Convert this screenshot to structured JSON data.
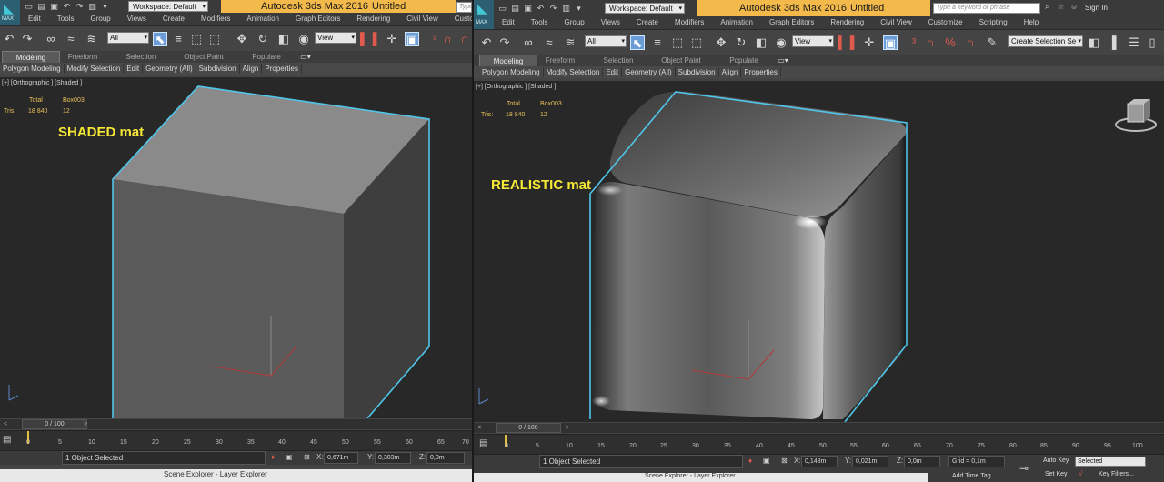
{
  "left": {
    "title": "Autodesk 3ds Max 2016",
    "untitled": "Untitled",
    "logo_text": "MAX",
    "workspace": "Workspace: Default",
    "search_partial": "Type",
    "menu": [
      "Edit",
      "Tools",
      "Group",
      "Views",
      "Create",
      "Modifiers",
      "Animation",
      "Graph Editors",
      "Rendering",
      "Civil View",
      "Customiz"
    ],
    "selection_filter": "All",
    "view_dropdown": "View",
    "ribbon_tabs": [
      "Modeling",
      "Freeform",
      "Selection",
      "Object Paint",
      "Populate"
    ],
    "sub_ribbon": [
      "Polygon Modeling",
      "Modify Selection",
      "Edit",
      "Geometry (All)",
      "Subdivision",
      "Align",
      "Properties"
    ],
    "viewport_label": "[+] [Orthographic ] [Shaded ]",
    "stats": {
      "total_label": "Total",
      "object_name": "Box003",
      "tris_label": "Tris:",
      "tris_total": "18 840",
      "tris_object": "12"
    },
    "annotation": "SHADED mat",
    "time_slider": "0 / 100",
    "ticks": [
      "0",
      "5",
      "10",
      "15",
      "20",
      "25",
      "30",
      "35",
      "40",
      "45",
      "50",
      "55",
      "60",
      "65",
      "70"
    ],
    "status": "1 Object Selected",
    "x_label": "X:",
    "x_value": "0,671m",
    "y_label": "Y:",
    "y_value": "0,303m",
    "z_label": "Z:",
    "z_value": "0,0m",
    "bottom_text": "Scene Explorer - Layer Explorer"
  },
  "right": {
    "title": "Autodesk 3ds Max 2016",
    "untitled": "Untitled",
    "logo_text": "MAX",
    "workspace": "Workspace: Default",
    "search_placeholder": "Type a keyword or phrase",
    "sign_in": "Sign In",
    "menu": [
      "Edit",
      "Tools",
      "Group",
      "Views",
      "Create",
      "Modifiers",
      "Animation",
      "Graph Editors",
      "Rendering",
      "Civil View",
      "Customize",
      "Scripting",
      "Help"
    ],
    "selection_filter": "All",
    "view_dropdown": "View",
    "create_selection_set": "Create Selection Se",
    "ribbon_tabs": [
      "Modeling",
      "Freeform",
      "Selection",
      "Object Paint",
      "Populate"
    ],
    "sub_ribbon": [
      "Polygon Modeling",
      "Modify Selection",
      "Edit",
      "Geometry (All)",
      "Subdivision",
      "Align",
      "Properties"
    ],
    "viewport_label": "[+] [Orthographic ] [Shaded ]",
    "stats": {
      "total_label": "Total",
      "object_name": "Box003",
      "tris_label": "Tris:",
      "tris_total": "18 840",
      "tris_object": "12"
    },
    "annotation": "REALISTIC mat",
    "time_slider": "0 / 100",
    "ticks": [
      "0",
      "5",
      "10",
      "15",
      "20",
      "25",
      "30",
      "35",
      "40",
      "45",
      "50",
      "55",
      "60",
      "65",
      "70",
      "75",
      "80",
      "85",
      "90",
      "95",
      "100"
    ],
    "status": "1 Object Selected",
    "x_label": "X:",
    "x_value": "0,148m",
    "y_label": "Y:",
    "y_value": "0,021m",
    "z_label": "Z:",
    "z_value": "0,0m",
    "grid": "Grid = 0,1m",
    "add_time_tag": "Add Time Tag",
    "auto_key": "Auto Key",
    "selected": "Selected",
    "set_key": "Set Key",
    "key_filters": "Key Filters...",
    "bottom_text": "Scene Explorer - Layer Explorer"
  },
  "colors": {
    "title_bar": "#f3b94a",
    "annotation": "#f6e936",
    "selection_outline": "#4fc6ea",
    "stats": "#e8c05a"
  }
}
